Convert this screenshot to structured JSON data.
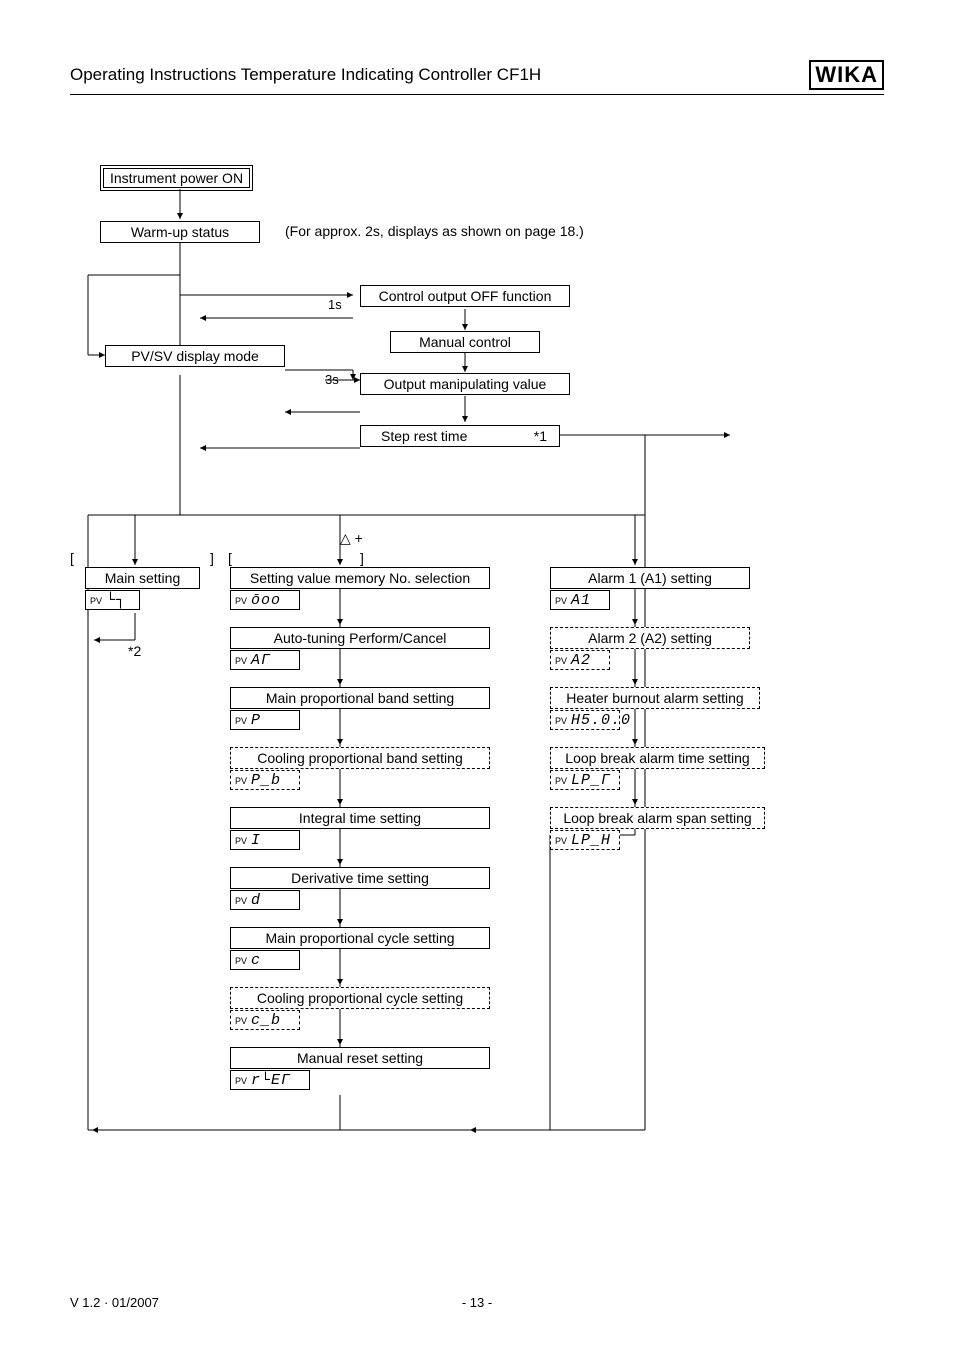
{
  "header": {
    "title": "Operating Instructions Temperature Indicating Controller CF1H",
    "logo": "WIKA"
  },
  "nodes": {
    "power_on": "Instrument power ON",
    "warmup": "Warm-up status",
    "warmup_note": "(For approx. 2s, displays as shown on page 18.)",
    "ctrl_off": "Control output OFF function",
    "manual": "Manual control",
    "pvsv": "PV/SV display mode",
    "out_mv": "Output manipulating value",
    "step_rest": "Step rest time",
    "star1": "*1",
    "triangle_plus": "△ +",
    "lbr": "[",
    "rbr": "]",
    "lbr2": "[",
    "rbr2": "]",
    "main_set": "Main setting",
    "star2": "*2",
    "svm": "Setting value memory No. selection",
    "at": "Auto-tuning Perform/Cancel",
    "mp": "Main proportional band setting",
    "cp": "Cooling proportional band setting",
    "it": "Integral time setting",
    "dt": "Derivative time setting",
    "mpc": "Main proportional cycle setting",
    "cpc": "Cooling proportional cycle setting",
    "mr": "Manual reset setting",
    "a1": "Alarm 1 (A1) setting",
    "a2": "Alarm 2 (A2) setting",
    "hb": "Heater burnout alarm setting",
    "lpt": "Loop break alarm time setting",
    "lps": "Loop break alarm span setting"
  },
  "pv": {
    "lbl": "PV",
    "main_set": "└┐",
    "svm": "ōoo",
    "at": "AΓ",
    "mp": "P",
    "cp": "P_b",
    "it": "I",
    "dt": "d",
    "mpc": "c",
    "cpc": "c_b",
    "mr": "r└EΓ",
    "a1": "A1",
    "a2": "A2",
    "hb": "H5.0.0",
    "lpt": "LP_Γ",
    "lps": "LP_H"
  },
  "time": {
    "t1": "1s",
    "t3": "3s"
  },
  "footer": {
    "ver": "V 1.2  ·  01/2007",
    "page": "- 13 -"
  }
}
